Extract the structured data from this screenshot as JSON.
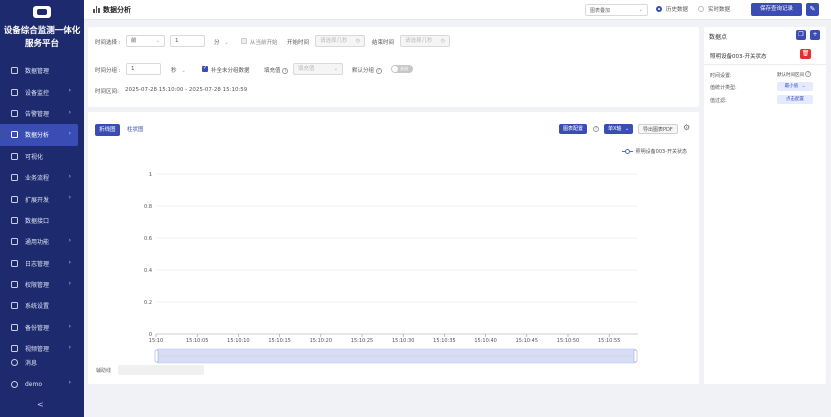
{
  "app": {
    "title_line1": "设备综合监测一体化",
    "title_line2": "服务平台"
  },
  "sidebar": {
    "items": [
      {
        "label": "数据管理",
        "icon": "database-icon",
        "has_arrow": false
      },
      {
        "label": "设备监控",
        "icon": "monitor-icon",
        "has_arrow": true
      },
      {
        "label": "告警管理",
        "icon": "alarm-icon",
        "has_arrow": true
      },
      {
        "label": "数据分析",
        "icon": "chart-icon",
        "has_arrow": true,
        "active": true
      },
      {
        "label": "可视化",
        "icon": "screen-icon",
        "has_arrow": false
      },
      {
        "label": "业务流程",
        "icon": "share-icon",
        "has_arrow": true
      },
      {
        "label": "扩展开发",
        "icon": "code-icon",
        "has_arrow": true
      },
      {
        "label": "数据接口",
        "icon": "link-icon",
        "has_arrow": false
      },
      {
        "label": "通用功能",
        "icon": "grid-icon",
        "has_arrow": true
      },
      {
        "label": "日志管理",
        "icon": "calendar-icon",
        "has_arrow": true
      },
      {
        "label": "权限管理",
        "icon": "lock-icon",
        "has_arrow": true
      },
      {
        "label": "系统设置",
        "icon": "gear-icon",
        "has_arrow": false
      },
      {
        "label": "备份管理",
        "icon": "backup-icon",
        "has_arrow": true
      },
      {
        "label": "视频管理",
        "icon": "video-icon",
        "has_arrow": true
      }
    ],
    "messages": "消息",
    "user": "demo",
    "collapse": "<"
  },
  "header": {
    "title": "数据分析",
    "chart_mode": "图表叠加",
    "radio_history": "历史数据",
    "radio_realtime": "实时数据",
    "save_btn": "保存查询记录",
    "pin_icon": "✎"
  },
  "filter": {
    "time_select_label": "时间选择 :",
    "time_dir": "前",
    "time_count": "1",
    "time_unit": "分",
    "from_now_label": "从当前开始",
    "start_label": "开始时间",
    "start_placeholder": "请选择几秒",
    "end_label": "结束时间",
    "end_placeholder": "请选择几秒",
    "group_label": "时间分组 :",
    "group_value": "1",
    "group_unit": "秒",
    "fill_missing_label": "补全未分组数据",
    "fill_value_label": "填充值",
    "fill_value_placeholder": "填充值",
    "default_group_label": "默认分组",
    "toggle_text": "关闭",
    "range_label": "时间区间:",
    "range_value": "2025-07-28 15:10:00 - 2025-07-28 15:10:59"
  },
  "chart_panel": {
    "tab_line": "折线图",
    "tab_bar": "柱状图",
    "config_btn": "图表配置",
    "axis_btn": "单X轴",
    "export_btn": "导出图表PDF",
    "aux_label": "辅助线"
  },
  "chart_data": {
    "type": "line",
    "x": [
      "15:10",
      "15:10:05",
      "15:10:10",
      "15:10:15",
      "15:10:20",
      "15:10:25",
      "15:10:30",
      "15:10:35",
      "15:10:40",
      "15:10:45",
      "15:10:50",
      "15:10:55"
    ],
    "yticks": [
      "0",
      "0.2",
      "0.4",
      "0.6",
      "0.8",
      "1"
    ],
    "ylim": [
      0,
      1
    ],
    "series": [
      {
        "name": "照明设备003-开关状态",
        "values": []
      }
    ],
    "legend": "top-right",
    "grid": true,
    "colors": {
      "series": "#5470c6",
      "grid": "#e6e6e6",
      "zoom": "#d6ddf5"
    }
  },
  "right_panel": {
    "title": "数据点",
    "device": "照明设备003-开关状态",
    "time_setting_label": "时间设置:",
    "time_setting_value": "默认时间区间",
    "stat_type_label": "值统计类型:",
    "stat_type_value": "最小值",
    "filter_label": "值过滤:",
    "filter_value": "点击配置"
  },
  "colors": {
    "brand": "#3a4db5",
    "sidebar": "#1d2a6e",
    "danger": "#e03131"
  }
}
